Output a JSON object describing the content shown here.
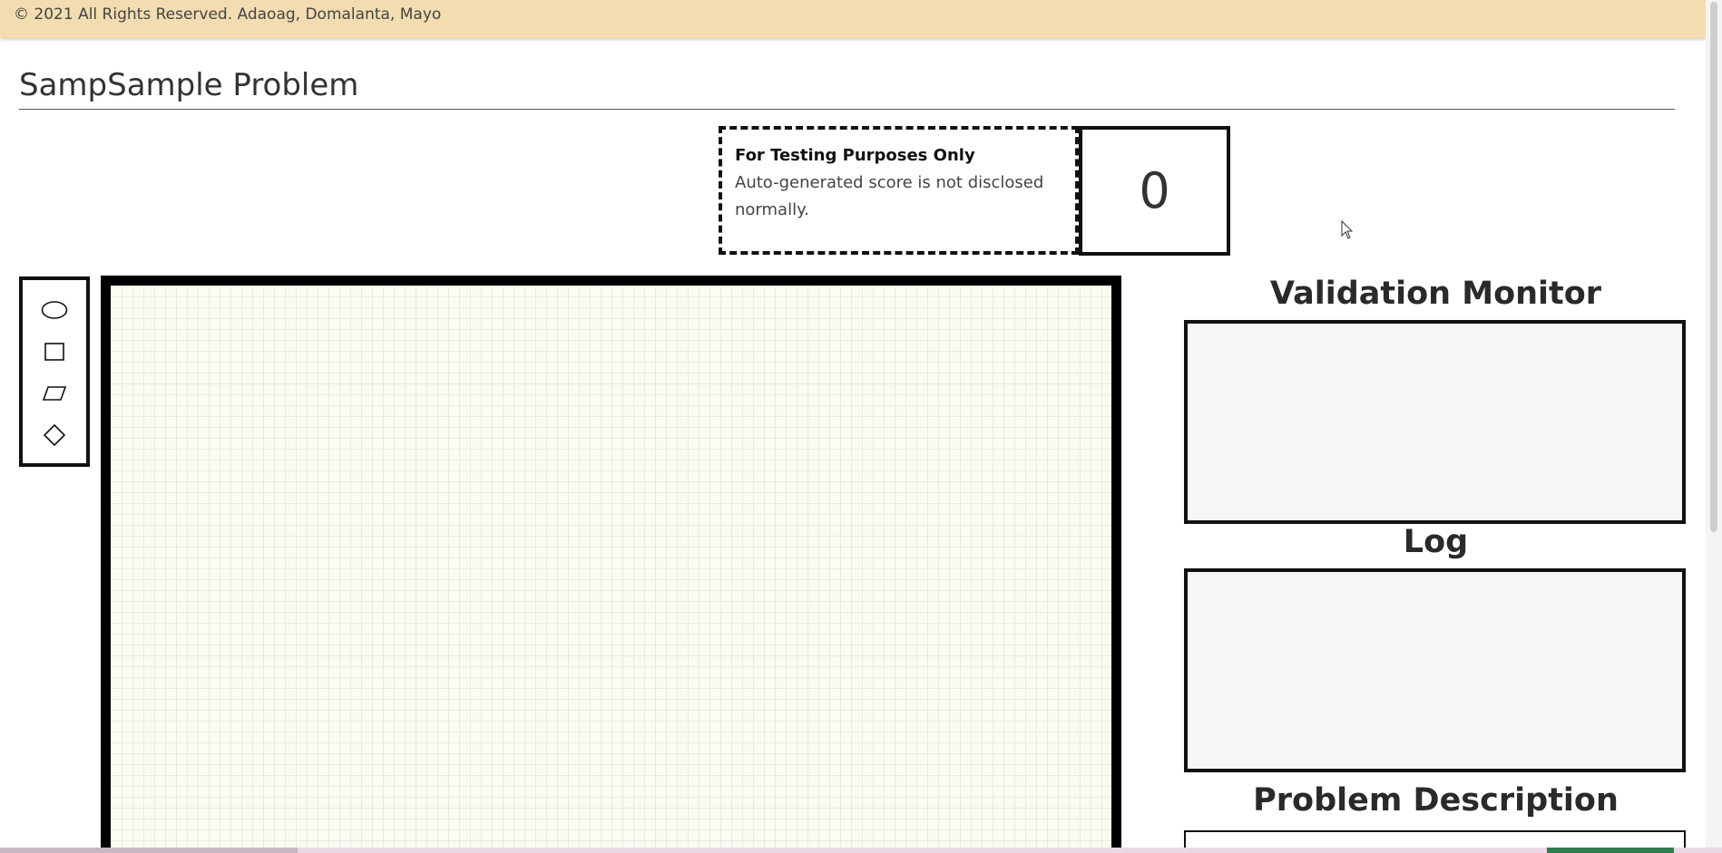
{
  "footer": {
    "copyright": "© 2021 All Rights Reserved. Adaoag, Domalanta, Mayo"
  },
  "page": {
    "title": "SampSample Problem"
  },
  "testing_notice": {
    "heading": "For Testing Purposes Only",
    "body": "Auto-generated score is not disclosed normally."
  },
  "score": {
    "value": "0"
  },
  "toolbar": {
    "tools": [
      {
        "name": "ellipse",
        "icon": "ellipse-icon"
      },
      {
        "name": "rectangle",
        "icon": "rectangle-icon"
      },
      {
        "name": "parallelogram",
        "icon": "parallelogram-icon"
      },
      {
        "name": "diamond",
        "icon": "diamond-icon"
      }
    ]
  },
  "panels": {
    "validation_monitor": {
      "title": "Validation Monitor"
    },
    "log": {
      "title": "Log"
    },
    "problem_description": {
      "title": "Problem Description"
    }
  },
  "colors": {
    "footer_bg": "#f3dcaf",
    "border": "#111111",
    "panel_bg": "#f6f6f8",
    "canvas_bg": "#fbfbf4",
    "grid_line": "#e6ece0"
  }
}
